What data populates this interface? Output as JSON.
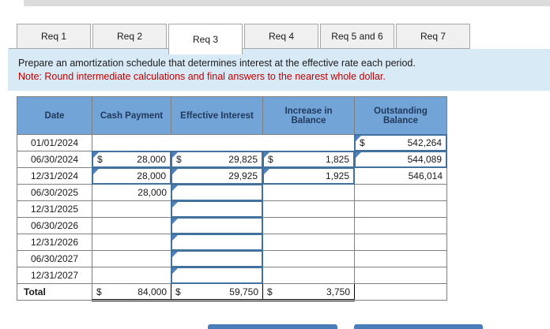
{
  "tabs": [
    {
      "label": "Req 1"
    },
    {
      "label": "Req 2"
    },
    {
      "label": "Req 3"
    },
    {
      "label": "Req 4"
    },
    {
      "label": "Req 5 and 6"
    },
    {
      "label": "Req 7"
    }
  ],
  "active_tab": "Req 3",
  "instructions": {
    "line1": "Prepare an amortization schedule that determines interest at the effective rate each period.",
    "line2": "Note: Round intermediate calculations and final answers to the nearest whole dollar."
  },
  "table": {
    "columns": [
      "Date",
      "Cash Payment",
      "Effective Interest",
      "Increase in Balance",
      "Outstanding Balance"
    ],
    "rows": [
      {
        "date": "01/01/2024",
        "cash": {
          "style": "blank",
          "span": 3
        },
        "balance": {
          "style": "input",
          "currency": "$",
          "value": "542,264"
        }
      },
      {
        "date": "06/30/2024",
        "cash": {
          "style": "input",
          "currency": "$",
          "value": "28,000"
        },
        "interest": {
          "style": "input",
          "currency": "$",
          "value": "29,825"
        },
        "increase": {
          "style": "input",
          "currency": "$",
          "value": "1,825"
        },
        "balance": {
          "style": "input",
          "currency": "",
          "value": "544,089"
        }
      },
      {
        "date": "12/31/2024",
        "cash": {
          "style": "input",
          "currency": "",
          "value": "28,000"
        },
        "interest": {
          "style": "input",
          "currency": "",
          "value": "29,925"
        },
        "increase": {
          "style": "input",
          "currency": "",
          "value": "1,925"
        },
        "balance": {
          "style": "plain",
          "currency": "",
          "value": "546,014"
        }
      },
      {
        "date": "06/30/2025",
        "cash": {
          "style": "plain",
          "currency": "",
          "value": "28,000"
        },
        "interest": {
          "style": "input",
          "currency": "",
          "value": ""
        },
        "increase": {
          "style": "plain",
          "value": ""
        },
        "balance": {
          "style": "plain",
          "value": ""
        }
      },
      {
        "date": "12/31/2025",
        "cash": {
          "style": "plain",
          "value": ""
        },
        "interest": {
          "style": "input",
          "currency": "",
          "value": ""
        },
        "increase": {
          "style": "plain",
          "value": ""
        },
        "balance": {
          "style": "plain",
          "value": ""
        }
      },
      {
        "date": "06/30/2026",
        "cash": {
          "style": "plain",
          "value": ""
        },
        "interest": {
          "style": "input",
          "currency": "",
          "value": ""
        },
        "increase": {
          "style": "plain",
          "value": ""
        },
        "balance": {
          "style": "plain",
          "value": ""
        }
      },
      {
        "date": "12/31/2026",
        "cash": {
          "style": "plain",
          "value": ""
        },
        "interest": {
          "style": "input",
          "currency": "",
          "value": ""
        },
        "increase": {
          "style": "plain",
          "value": ""
        },
        "balance": {
          "style": "plain",
          "value": ""
        }
      },
      {
        "date": "06/30/2027",
        "cash": {
          "style": "plain",
          "value": ""
        },
        "interest": {
          "style": "input",
          "currency": "",
          "value": ""
        },
        "increase": {
          "style": "plain",
          "value": ""
        },
        "balance": {
          "style": "plain",
          "value": ""
        }
      },
      {
        "date": "12/31/2027",
        "cash": {
          "style": "plain",
          "value": ""
        },
        "interest": {
          "style": "input",
          "currency": "",
          "value": ""
        },
        "increase": {
          "style": "plain",
          "value": ""
        },
        "balance": {
          "style": "plain",
          "value": ""
        }
      }
    ],
    "total": {
      "label": "Total",
      "cash": {
        "currency": "$",
        "value": "84,000"
      },
      "interest": {
        "currency": "$",
        "value": "59,750"
      },
      "increase": {
        "currency": "$",
        "value": "3,750"
      }
    }
  },
  "colors": {
    "header_blue": "#73a4d8",
    "instruction_bg": "#d9eaf7",
    "note_red": "#c00000",
    "input_border": "#41719c",
    "flag_blue": "#4f81bd",
    "grid_border": "#7f7f7f",
    "tab_bg": "#f0f0f0",
    "topbar_gray": "#dcdcdc",
    "nav_button_blue": "#4a7ebb"
  }
}
